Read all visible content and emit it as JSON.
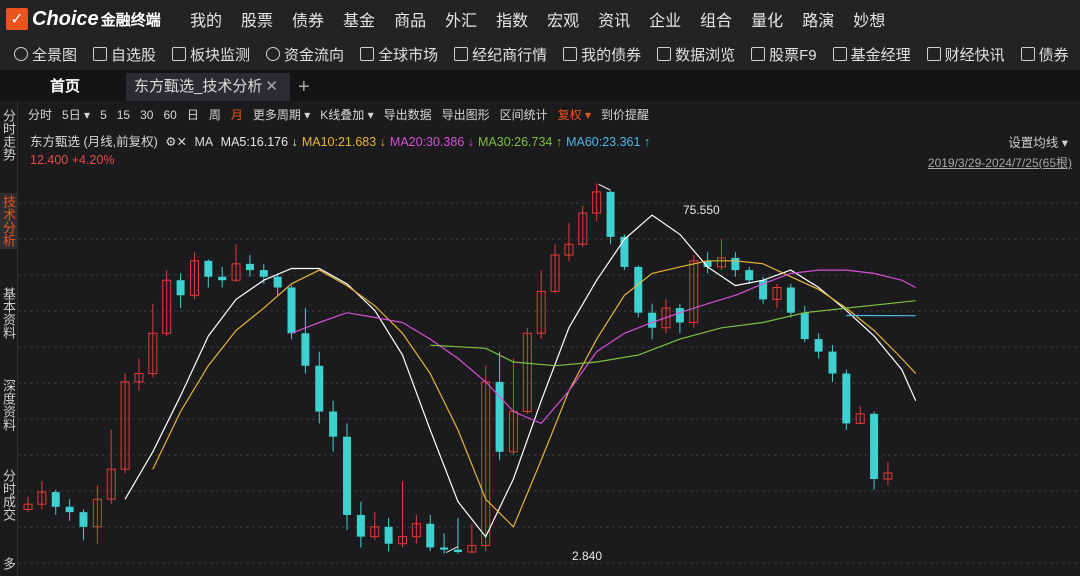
{
  "app": {
    "logo_mark": "✓",
    "logo_text": "Choice",
    "logo_sub": "金融终端"
  },
  "main_nav": [
    "我的",
    "股票",
    "债券",
    "基金",
    "商品",
    "外汇",
    "指数",
    "宏观",
    "资讯",
    "企业",
    "组合",
    "量化",
    "路演",
    "妙想"
  ],
  "toolbar": [
    "全景图",
    "自选股",
    "板块监测",
    "资金流向",
    "全球市场",
    "经纪商行情",
    "我的债券",
    "数据浏览",
    "股票F9",
    "基金经理",
    "财经快讯",
    "债券"
  ],
  "tabs": {
    "home": "首页",
    "active": "东方甄选_技术分析",
    "close": "✕",
    "add": "+"
  },
  "sidebar": [
    {
      "label": "分时走势",
      "active": false
    },
    {
      "label": "技术分析",
      "active": true
    },
    {
      "label": "基本资料",
      "active": false
    },
    {
      "label": "深度资料",
      "active": false
    },
    {
      "label": "分时成交",
      "active": false
    },
    {
      "label": "多",
      "active": false
    }
  ],
  "chart_toolbar": [
    "分时",
    "5日 ▾",
    "5",
    "15",
    "30",
    "60",
    "日",
    "周",
    "月",
    "更多周期 ▾",
    "K线叠加 ▾",
    "导出数据",
    "导出图形",
    "区间统计",
    "复权 ▾",
    "到价提醒"
  ],
  "chart_toolbar_active": [
    "月",
    "复权 ▾"
  ],
  "chart_info": {
    "title": "东方甄选 (月线,前复权)",
    "icons": "⚙✕",
    "ma_label": "MA",
    "ma_values": [
      {
        "text": "MA5:16.176 ↓",
        "color": "#e6e6e6"
      },
      {
        "text": "MA10:21.683 ↓",
        "color": "#e6b43a"
      },
      {
        "text": "MA20:30.386 ↓",
        "color": "#d64fd6"
      },
      {
        "text": "MA30:26.734 ↑",
        "color": "#7dc242"
      },
      {
        "text": "MA60:23.361 ↑",
        "color": "#4cb8e6"
      }
    ],
    "price": "12.400 +4.20%",
    "settings": "设置均线 ▾",
    "range": "2019/3/29-2024/7/25(65根)"
  },
  "chart_data": {
    "type": "candlestick",
    "period": "monthly",
    "bars": 65,
    "high_label": "75.550",
    "low_label": "2.840",
    "ylim": [
      2.5,
      82
    ],
    "grid": true,
    "colors": {
      "up": "#e63a3a",
      "down": "#3fd1cf"
    },
    "candles": [
      [
        4.2,
        4.4,
        4.7,
        4.1
      ],
      [
        4.4,
        4.9,
        5.4,
        4.2
      ],
      [
        4.9,
        4.3,
        5.0,
        4.0
      ],
      [
        4.3,
        4.1,
        4.6,
        3.8
      ],
      [
        4.1,
        3.6,
        4.2,
        3.2
      ],
      [
        3.6,
        4.6,
        5.2,
        3.1
      ],
      [
        4.6,
        6.0,
        8.5,
        4.4
      ],
      [
        6.0,
        13.0,
        14.0,
        5.8
      ],
      [
        13.0,
        14.0,
        16.0,
        12.0
      ],
      [
        14.0,
        20.0,
        26.0,
        13.5
      ],
      [
        20.0,
        32.0,
        35.0,
        19.5
      ],
      [
        32.0,
        28.0,
        34.0,
        25.0
      ],
      [
        28.0,
        38.0,
        41.0,
        27.0
      ],
      [
        38.0,
        33.0,
        38.5,
        30.0
      ],
      [
        33.0,
        32.0,
        36.0,
        30.0
      ],
      [
        32.0,
        37.0,
        44.0,
        31.5
      ],
      [
        37.0,
        35.0,
        40.0,
        33.0
      ],
      [
        35.0,
        33.0,
        37.0,
        31.0
      ],
      [
        33.0,
        30.0,
        34.0,
        28.0
      ],
      [
        30.0,
        20.0,
        30.5,
        19.0
      ],
      [
        20.0,
        15.0,
        25.0,
        14.0
      ],
      [
        15.0,
        10.0,
        17.0,
        9.0
      ],
      [
        10.0,
        8.0,
        11.0,
        7.0
      ],
      [
        8.0,
        4.0,
        9.0,
        3.5
      ],
      [
        4.0,
        3.3,
        4.5,
        3.0
      ],
      [
        3.3,
        3.6,
        4.1,
        3.2
      ],
      [
        3.6,
        3.1,
        3.9,
        2.9
      ],
      [
        3.1,
        3.3,
        5.4,
        3.0
      ],
      [
        3.3,
        3.7,
        4.0,
        3.1
      ],
      [
        3.7,
        3.0,
        4.0,
        2.9
      ],
      [
        3.0,
        2.94,
        3.4,
        2.84
      ],
      [
        2.94,
        2.88,
        3.9,
        2.84
      ],
      [
        2.88,
        3.05,
        3.7,
        2.85
      ],
      [
        3.05,
        13.0,
        15.0,
        2.9
      ],
      [
        13.0,
        7.0,
        17.0,
        6.5
      ],
      [
        7.0,
        10.0,
        16.0,
        6.8
      ],
      [
        10.0,
        20.0,
        21.0,
        9.8
      ],
      [
        20.0,
        29.0,
        35.0,
        19.0
      ],
      [
        29.0,
        40.0,
        44.0,
        28.5
      ],
      [
        40.0,
        44.0,
        53.0,
        38.0
      ],
      [
        44.0,
        58.0,
        62.0,
        43.0
      ],
      [
        58.0,
        70.0,
        75.55,
        54.0
      ],
      [
        70.0,
        47.0,
        70.5,
        44.0
      ],
      [
        47.0,
        36.0,
        48.0,
        35.0
      ],
      [
        36.0,
        24.0,
        36.5,
        23.0
      ],
      [
        24.0,
        21.0,
        26.0,
        19.0
      ],
      [
        21.0,
        25.0,
        27.0,
        20.0
      ],
      [
        25.0,
        22.0,
        26.0,
        20.0
      ],
      [
        22.0,
        38.0,
        40.0,
        21.0
      ],
      [
        38.0,
        36.0,
        41.0,
        34.0
      ],
      [
        36.0,
        39.0,
        46.0,
        35.0
      ],
      [
        39.0,
        35.0,
        41.0,
        33.0
      ],
      [
        35.0,
        32.0,
        36.0,
        31.0
      ],
      [
        32.0,
        27.0,
        33.0,
        26.0
      ],
      [
        27.0,
        30.0,
        31.0,
        25.0
      ],
      [
        30.0,
        24.0,
        31.0,
        23.0
      ],
      [
        24.0,
        19.0,
        25.5,
        18.5
      ],
      [
        19.0,
        17.0,
        20.0,
        16.0
      ],
      [
        17.0,
        14.0,
        18.0,
        13.0
      ],
      [
        14.0,
        9.0,
        14.5,
        8.5
      ],
      [
        9.0,
        9.8,
        10.5,
        9.0
      ],
      [
        9.8,
        5.5,
        10.0,
        5.0
      ],
      [
        5.5,
        5.8,
        6.4,
        5.2
      ]
    ],
    "ma": [
      {
        "name": "MA5",
        "color": "#ffffff",
        "points": [
          [
            7,
            4.6
          ],
          [
            9,
            7.0
          ],
          [
            11,
            11.5
          ],
          [
            13,
            19.5
          ],
          [
            15,
            27.0
          ],
          [
            17,
            32.0
          ],
          [
            19,
            35.5
          ],
          [
            21,
            35.5
          ],
          [
            23,
            31.0
          ],
          [
            25,
            24.5
          ],
          [
            27,
            16.5
          ],
          [
            29,
            8.5
          ],
          [
            31,
            4.5
          ],
          [
            33,
            3.3
          ],
          [
            35,
            5.5
          ],
          [
            37,
            11.0
          ],
          [
            39,
            21.0
          ],
          [
            41,
            32.0
          ],
          [
            43,
            46.0
          ],
          [
            45,
            57.0
          ],
          [
            47,
            48.0
          ],
          [
            49,
            36.0
          ],
          [
            51,
            30.5
          ],
          [
            53,
            32.0
          ],
          [
            55,
            35.0
          ],
          [
            57,
            30.0
          ],
          [
            59,
            24.5
          ],
          [
            61,
            19.5
          ],
          [
            63,
            14.5
          ],
          [
            64,
            11.0
          ]
        ]
      },
      {
        "name": "MA10",
        "color": "#e6b43a",
        "points": [
          [
            9,
            6.0
          ],
          [
            11,
            10.0
          ],
          [
            13,
            15.0
          ],
          [
            15,
            20.5
          ],
          [
            17,
            25.0
          ],
          [
            19,
            31.0
          ],
          [
            21,
            35.0
          ],
          [
            23,
            30.5
          ],
          [
            25,
            25.5
          ],
          [
            27,
            20.0
          ],
          [
            29,
            14.0
          ],
          [
            31,
            8.5
          ],
          [
            33,
            4.6
          ],
          [
            35,
            3.6
          ],
          [
            37,
            6.5
          ],
          [
            39,
            12.0
          ],
          [
            41,
            19.0
          ],
          [
            43,
            28.0
          ],
          [
            45,
            34.0
          ],
          [
            47,
            36.0
          ],
          [
            49,
            38.0
          ],
          [
            51,
            38.0
          ],
          [
            53,
            37.0
          ],
          [
            55,
            33.0
          ],
          [
            57,
            29.5
          ],
          [
            59,
            25.0
          ],
          [
            61,
            20.5
          ],
          [
            63,
            16.0
          ],
          [
            64,
            14.0
          ]
        ]
      },
      {
        "name": "MA20",
        "color": "#d64fd6",
        "points": [
          [
            19,
            20.0
          ],
          [
            21,
            22.0
          ],
          [
            23,
            24.0
          ],
          [
            25,
            23.0
          ],
          [
            27,
            22.0
          ],
          [
            29,
            19.0
          ],
          [
            31,
            16.0
          ],
          [
            33,
            13.0
          ],
          [
            35,
            10.0
          ],
          [
            37,
            9.0
          ],
          [
            39,
            12.0
          ],
          [
            41,
            17.0
          ],
          [
            43,
            20.0
          ],
          [
            45,
            22.0
          ],
          [
            47,
            24.0
          ],
          [
            49,
            26.0
          ],
          [
            51,
            28.0
          ],
          [
            53,
            31.0
          ],
          [
            55,
            34.0
          ],
          [
            57,
            35.0
          ],
          [
            59,
            35.0
          ],
          [
            61,
            34.0
          ],
          [
            63,
            32.0
          ],
          [
            64,
            30.0
          ]
        ]
      },
      {
        "name": "MA30",
        "color": "#7dc242",
        "points": [
          [
            29,
            18.0
          ],
          [
            33,
            17.5
          ],
          [
            35,
            15.5
          ],
          [
            38,
            15.0
          ],
          [
            41,
            15.5
          ],
          [
            44,
            16.5
          ],
          [
            47,
            19.0
          ],
          [
            50,
            21.0
          ],
          [
            53,
            22.0
          ],
          [
            56,
            24.0
          ],
          [
            59,
            25.0
          ],
          [
            62,
            26.0
          ],
          [
            64,
            26.7
          ]
        ]
      },
      {
        "name": "MA60",
        "color": "#4cb8e6",
        "points": [
          [
            59,
            23.4
          ],
          [
            64,
            23.36
          ]
        ]
      }
    ]
  }
}
